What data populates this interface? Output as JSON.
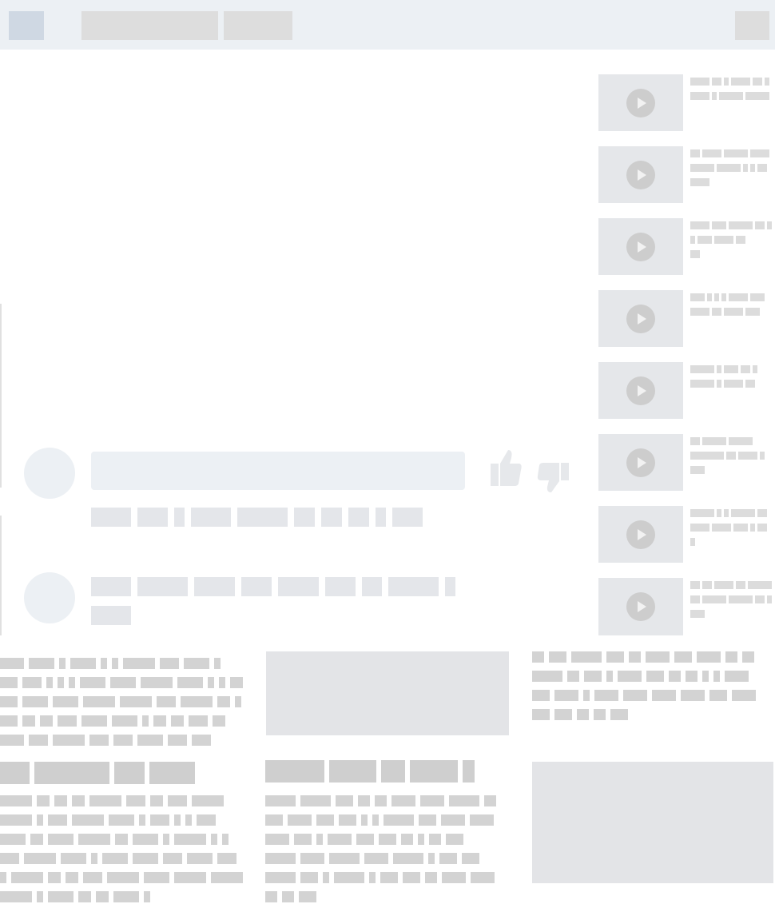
{
  "app": {
    "state": "loading skeleton"
  },
  "icons": {
    "like": "thumbs-up-icon",
    "dislike": "thumbs-down-icon",
    "play": "play-icon"
  },
  "colors": {
    "header_bg": "#ecf0f4",
    "skeleton": "#dcdcdc",
    "thumbnail_bg": "#e5e7ea"
  }
}
